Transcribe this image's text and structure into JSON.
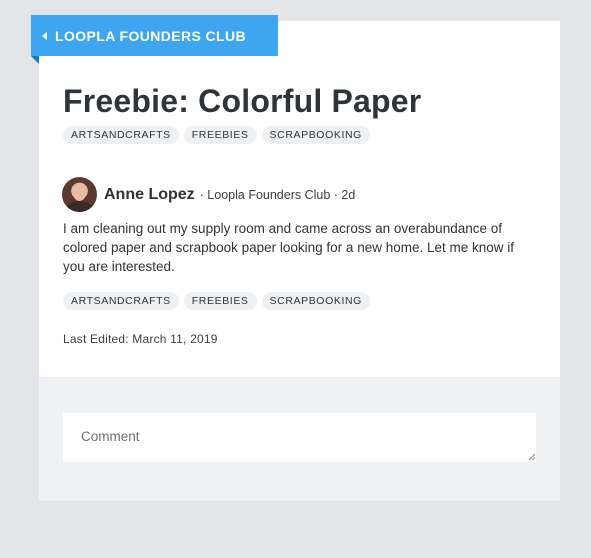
{
  "group": {
    "name": "LOOPLA FOUNDERS CLUB"
  },
  "post": {
    "title": "Freebie: Colorful Paper",
    "tags_top": [
      "ARTSANDCRAFTS",
      "FREEBIES",
      "SCRAPBOOKING"
    ],
    "author": "Anne Lopez",
    "meta": "· Loopla Founders Club · 2d",
    "body": "I am cleaning out my supply room and came across an overabundance of colored paper and scrapbook paper looking for a new home. Let me know if you are interested.",
    "tags_bottom": [
      "ARTSANDCRAFTS",
      "FREEBIES",
      "SCRAPBOOKING"
    ],
    "last_edited": "Last Edited: March 11, 2019"
  },
  "comment": {
    "placeholder": "Comment"
  },
  "colors": {
    "accent": "#3ea5f0",
    "background": "#e3e5e8",
    "tag_bg": "#eef0f2"
  }
}
